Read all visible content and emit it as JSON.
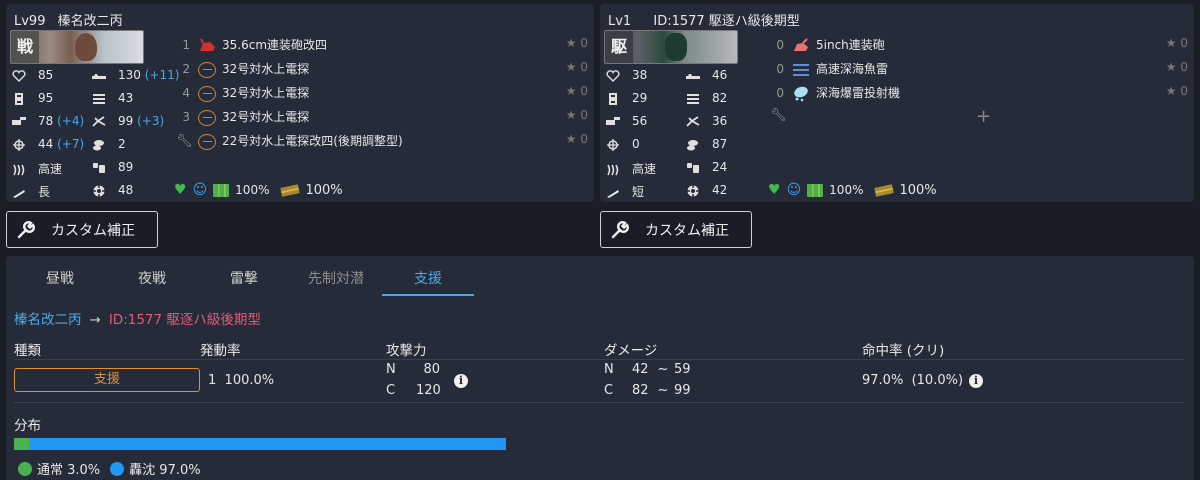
{
  "ship1": {
    "level": "Lv99",
    "name": "榛名改二丙",
    "banner_tag": "戦",
    "stats_left": [
      {
        "icon": "heart-icon",
        "value": "85"
      },
      {
        "icon": "armor-icon",
        "value": "95"
      },
      {
        "icon": "firepower-icon",
        "value": "78",
        "bonus": "(+4)"
      },
      {
        "icon": "evasion-icon",
        "value": "44",
        "bonus": "(+7)"
      },
      {
        "icon": "speed-icon",
        "value": "高速"
      },
      {
        "icon": "range-icon",
        "value": "長"
      }
    ],
    "stats_right": [
      {
        "icon": "aircraft-icon",
        "value": "130",
        "bonus": "(+11)"
      },
      {
        "icon": "torpedo-icon",
        "value": "43"
      },
      {
        "icon": "antiair-icon",
        "value": "99",
        "bonus": "(+3)"
      },
      {
        "icon": "asw-icon",
        "value": "2"
      },
      {
        "icon": "los-icon",
        "value": "89"
      },
      {
        "icon": "luck-icon",
        "value": "48"
      }
    ],
    "equipment": [
      {
        "slot": "1",
        "name": "35.6cm連装砲改四",
        "icon": "main-gun-icon",
        "star": "★ 0"
      },
      {
        "slot": "2",
        "name": "32号対水上電探",
        "icon": "radar-icon",
        "star": "★ 0"
      },
      {
        "slot": "4",
        "name": "32号対水上電探",
        "icon": "radar-icon",
        "star": "★ 0"
      },
      {
        "slot": "3",
        "name": "32号対水上電探",
        "icon": "radar-icon",
        "star": "★ 0"
      },
      {
        "slot": "",
        "name": "22号対水上電探改四(後期調整型)",
        "icon": "radar-icon",
        "star": "★ 0"
      }
    ],
    "fuel": "100%",
    "ammo": "100%"
  },
  "ship2": {
    "level": "Lv1",
    "name": "ID:1577 駆逐ハ級後期型",
    "banner_tag": "駆",
    "stats_left": [
      {
        "icon": "heart-icon",
        "value": "38"
      },
      {
        "icon": "armor-icon",
        "value": "29"
      },
      {
        "icon": "firepower-icon",
        "value": "56"
      },
      {
        "icon": "evasion-icon",
        "value": "0"
      },
      {
        "icon": "speed-icon",
        "value": "高速"
      },
      {
        "icon": "range-icon",
        "value": "短"
      }
    ],
    "stats_right": [
      {
        "icon": "aircraft-icon",
        "value": "46"
      },
      {
        "icon": "torpedo-icon",
        "value": "82"
      },
      {
        "icon": "antiair-icon",
        "value": "36"
      },
      {
        "icon": "asw-icon",
        "value": "87"
      },
      {
        "icon": "los-icon",
        "value": "24"
      },
      {
        "icon": "luck-icon",
        "value": "42"
      }
    ],
    "equipment": [
      {
        "slot": "0",
        "name": "5inch連装砲",
        "icon": "main-gun-icon",
        "star": "★ 0"
      },
      {
        "slot": "0",
        "name": "高速深海魚雷",
        "icon": "torpedo-equip-icon",
        "star": "★ 0"
      },
      {
        "slot": "0",
        "name": "深海爆雷投射機",
        "icon": "depth-charge-icon",
        "star": "★ 0"
      }
    ],
    "add_equipment": "+",
    "fuel": "100%",
    "ammo": "100%"
  },
  "custom_button_label": "カスタム補正",
  "tabs": [
    {
      "label": "昼戦",
      "state": "normal"
    },
    {
      "label": "夜戦",
      "state": "normal"
    },
    {
      "label": "雷撃",
      "state": "normal"
    },
    {
      "label": "先制対潜",
      "state": "disabled"
    },
    {
      "label": "支援",
      "state": "active"
    }
  ],
  "route": {
    "attacker": "榛名改二丙",
    "arrow": "→",
    "defender": "ID:1577 駆逐ハ級後期型"
  },
  "table": {
    "headers": {
      "type": "種類",
      "rate": "発動率",
      "power": "攻撃力",
      "damage": "ダメージ",
      "hit": "命中率 (クリ)"
    },
    "row": {
      "type": "支援",
      "rate_count": "1",
      "rate": "100.0%",
      "power_n_label": "N",
      "power_n": "80",
      "power_c_label": "C",
      "power_c": "120",
      "dmg_n_label": "N",
      "dmg_n_min": "42",
      "dmg_n_sep": "~",
      "dmg_n_max": "59",
      "dmg_c_label": "C",
      "dmg_c_min": "82",
      "dmg_c_sep": "~",
      "dmg_c_max": "99",
      "hit": "97.0%",
      "crit": "(10.0%)"
    }
  },
  "distribution": {
    "title": "分布",
    "items": [
      {
        "label": "通常 3.0%",
        "fraction": 0.03,
        "color": "#4caf50"
      },
      {
        "label": "轟沈 97.0%",
        "fraction": 0.97,
        "color": "#2196f3"
      }
    ]
  }
}
